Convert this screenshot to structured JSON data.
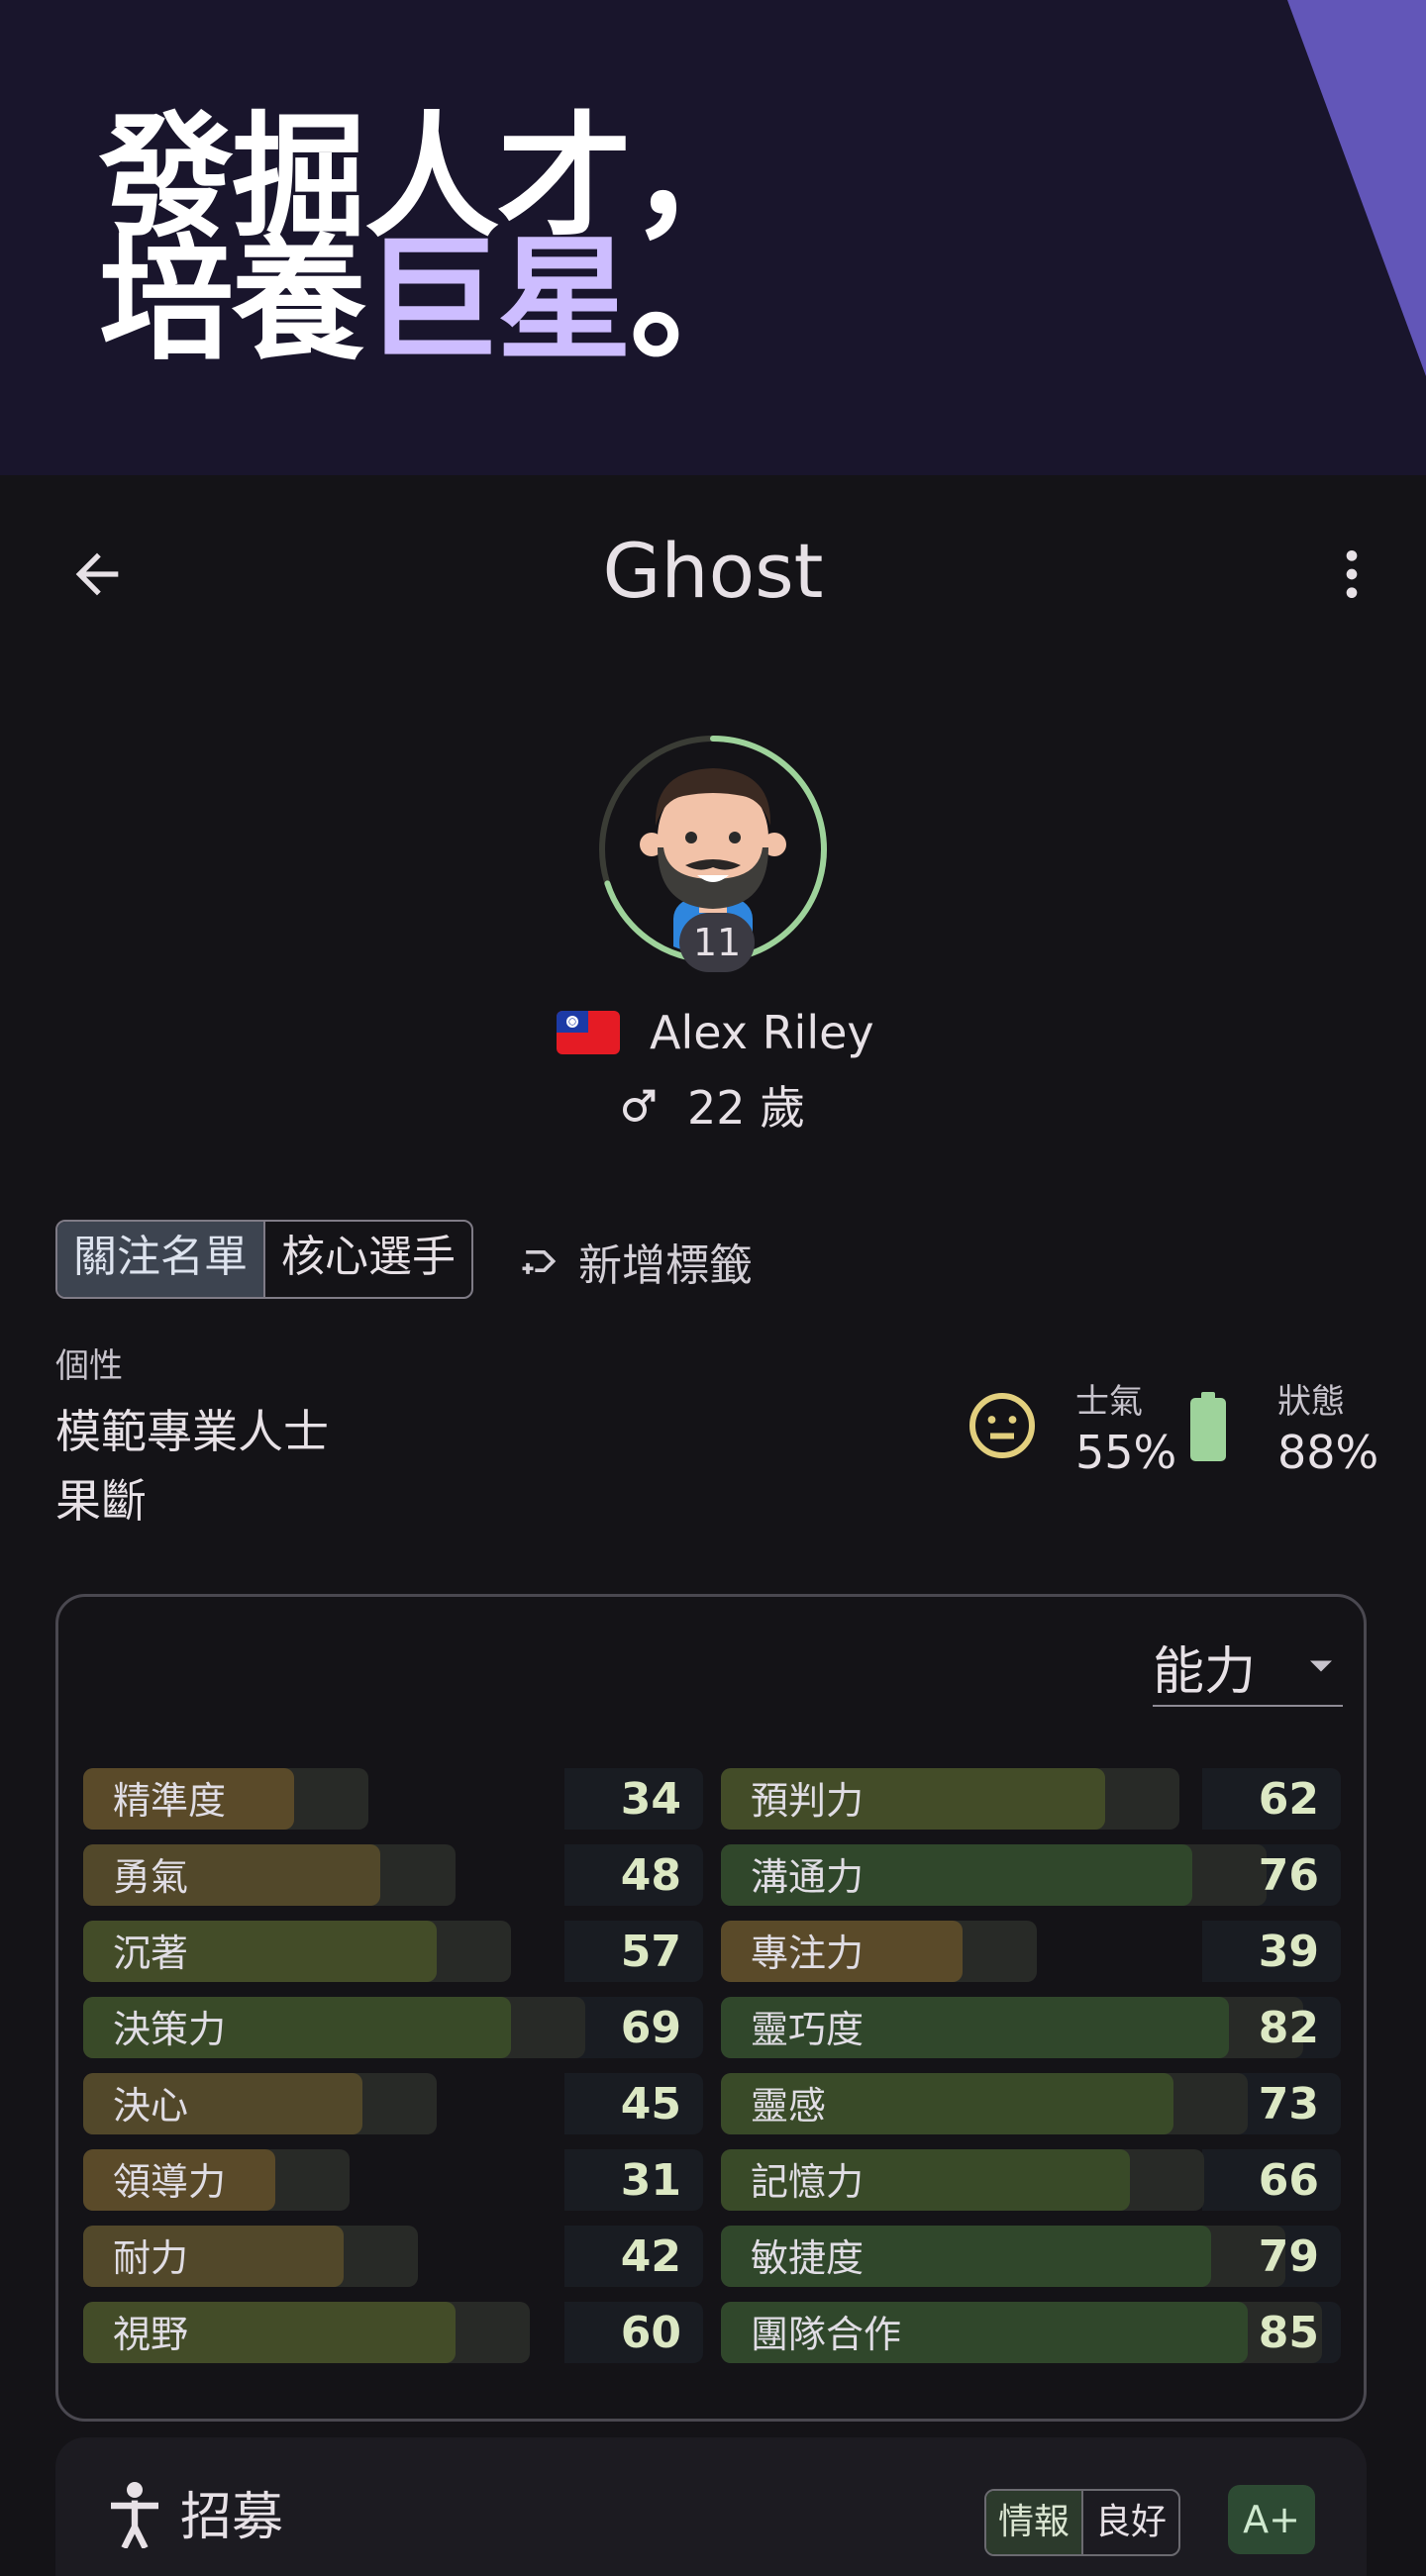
{
  "banner": {
    "line1": "發掘人才，",
    "line2_plain": "培養",
    "line2_accent": "巨星",
    "line2_end": "。"
  },
  "appbar": {
    "title": "Ghost",
    "back_icon": "arrow-back-icon",
    "more_icon": "more-vert-icon"
  },
  "player": {
    "jersey_number": "11",
    "name": "Alex Riley",
    "nationality_flag": "taiwan-flag-icon",
    "gender_icon": "male-icon",
    "age": "22 歲",
    "rating_ring_progress": 0.7
  },
  "tags": {
    "items": [
      "關注名單",
      "核心選手"
    ],
    "selected": "關注名單",
    "add_label": "新增標籤"
  },
  "personality": {
    "label": "個性",
    "traits": [
      "模範專業人士",
      "果斷"
    ]
  },
  "status": {
    "morale_label": "士氣",
    "morale_value": "55%",
    "condition_label": "狀態",
    "condition_value": "88%"
  },
  "attributes": {
    "dropdown_label": "能力",
    "left": [
      {
        "label": "精準度",
        "value": 34
      },
      {
        "label": "勇氣",
        "value": 48
      },
      {
        "label": "沉著",
        "value": 57
      },
      {
        "label": "決策力",
        "value": 69
      },
      {
        "label": "決心",
        "value": 45
      },
      {
        "label": "領導力",
        "value": 31
      },
      {
        "label": "耐力",
        "value": 42
      },
      {
        "label": "視野",
        "value": 60
      }
    ],
    "right": [
      {
        "label": "預判力",
        "value": 62
      },
      {
        "label": "溝通力",
        "value": 76
      },
      {
        "label": "專注力",
        "value": 39
      },
      {
        "label": "靈巧度",
        "value": 82
      },
      {
        "label": "靈感",
        "value": 73
      },
      {
        "label": "記憶力",
        "value": 66
      },
      {
        "label": "敏捷度",
        "value": 79
      },
      {
        "label": "團隊合作",
        "value": 85
      }
    ]
  },
  "recruit": {
    "label": "招募",
    "chip_a": "情報",
    "chip_b": "良好",
    "grade": "A+"
  },
  "colors": {
    "banner_bg": "#19152c",
    "banner_accent": "#cdbdff",
    "stripe": "#6256b8",
    "app_bg": "#141317",
    "ring": "#9ed39b",
    "morale_icon": "#e2cf7e",
    "condition_icon": "#9ed39b"
  }
}
